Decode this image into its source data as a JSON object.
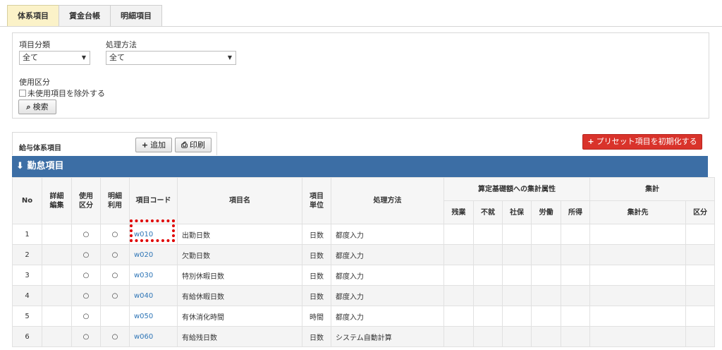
{
  "tabs": [
    "体系項目",
    "賃金台帳",
    "明細項目"
  ],
  "filter": {
    "category_label": "項目分類",
    "category_value": "全て",
    "method_label": "処理方法",
    "method_value": "全て",
    "usage_label": "使用区分",
    "exclude_unused_label": "未使用項目を除外する",
    "search_label": "検索"
  },
  "section": {
    "title": "給与体系項目",
    "add_label": "追加",
    "print_label": "印刷",
    "reset_preset_label": "プリセット項目を初期化する",
    "band_title": "勤怠項目"
  },
  "columns": {
    "no": "No",
    "detail": "詳細\n編集",
    "use": "使用\n区分",
    "detail_use": "明細\n利用",
    "code": "項目コード",
    "name": "項目名",
    "unit": "項目\n単位",
    "method": "処理方法",
    "calc_group": "算定基礎額への集計属性",
    "calc": [
      "残業",
      "不就",
      "社保",
      "労働",
      "所得"
    ],
    "agg_group": "集計",
    "agg_target": "集計先",
    "agg_type": "区分"
  },
  "rows": [
    {
      "no": "1",
      "use": "○",
      "detail_use": "○",
      "code": "w010",
      "name": "出勤日数",
      "unit": "日数",
      "method": "都度入力"
    },
    {
      "no": "2",
      "use": "○",
      "detail_use": "○",
      "code": "w020",
      "name": "欠勤日数",
      "unit": "日数",
      "method": "都度入力"
    },
    {
      "no": "3",
      "use": "○",
      "detail_use": "○",
      "code": "w030",
      "name": "特別休暇日数",
      "unit": "日数",
      "method": "都度入力"
    },
    {
      "no": "4",
      "use": "○",
      "detail_use": "○",
      "code": "w040",
      "name": "有給休暇日数",
      "unit": "日数",
      "method": "都度入力"
    },
    {
      "no": "5",
      "use": "○",
      "detail_use": "",
      "code": "w050",
      "name": "有休消化時間",
      "unit": "時間",
      "method": "都度入力"
    },
    {
      "no": "6",
      "use": "○",
      "detail_use": "○",
      "code": "w060",
      "name": "有給残日数",
      "unit": "日数",
      "method": "システム自動計算"
    }
  ],
  "colors": {
    "band": "#3c6ea5",
    "reset_button": "#d9332b",
    "active_tab": "#fbf2c8",
    "link": "#2e75b6",
    "highlight": "#e00000"
  }
}
